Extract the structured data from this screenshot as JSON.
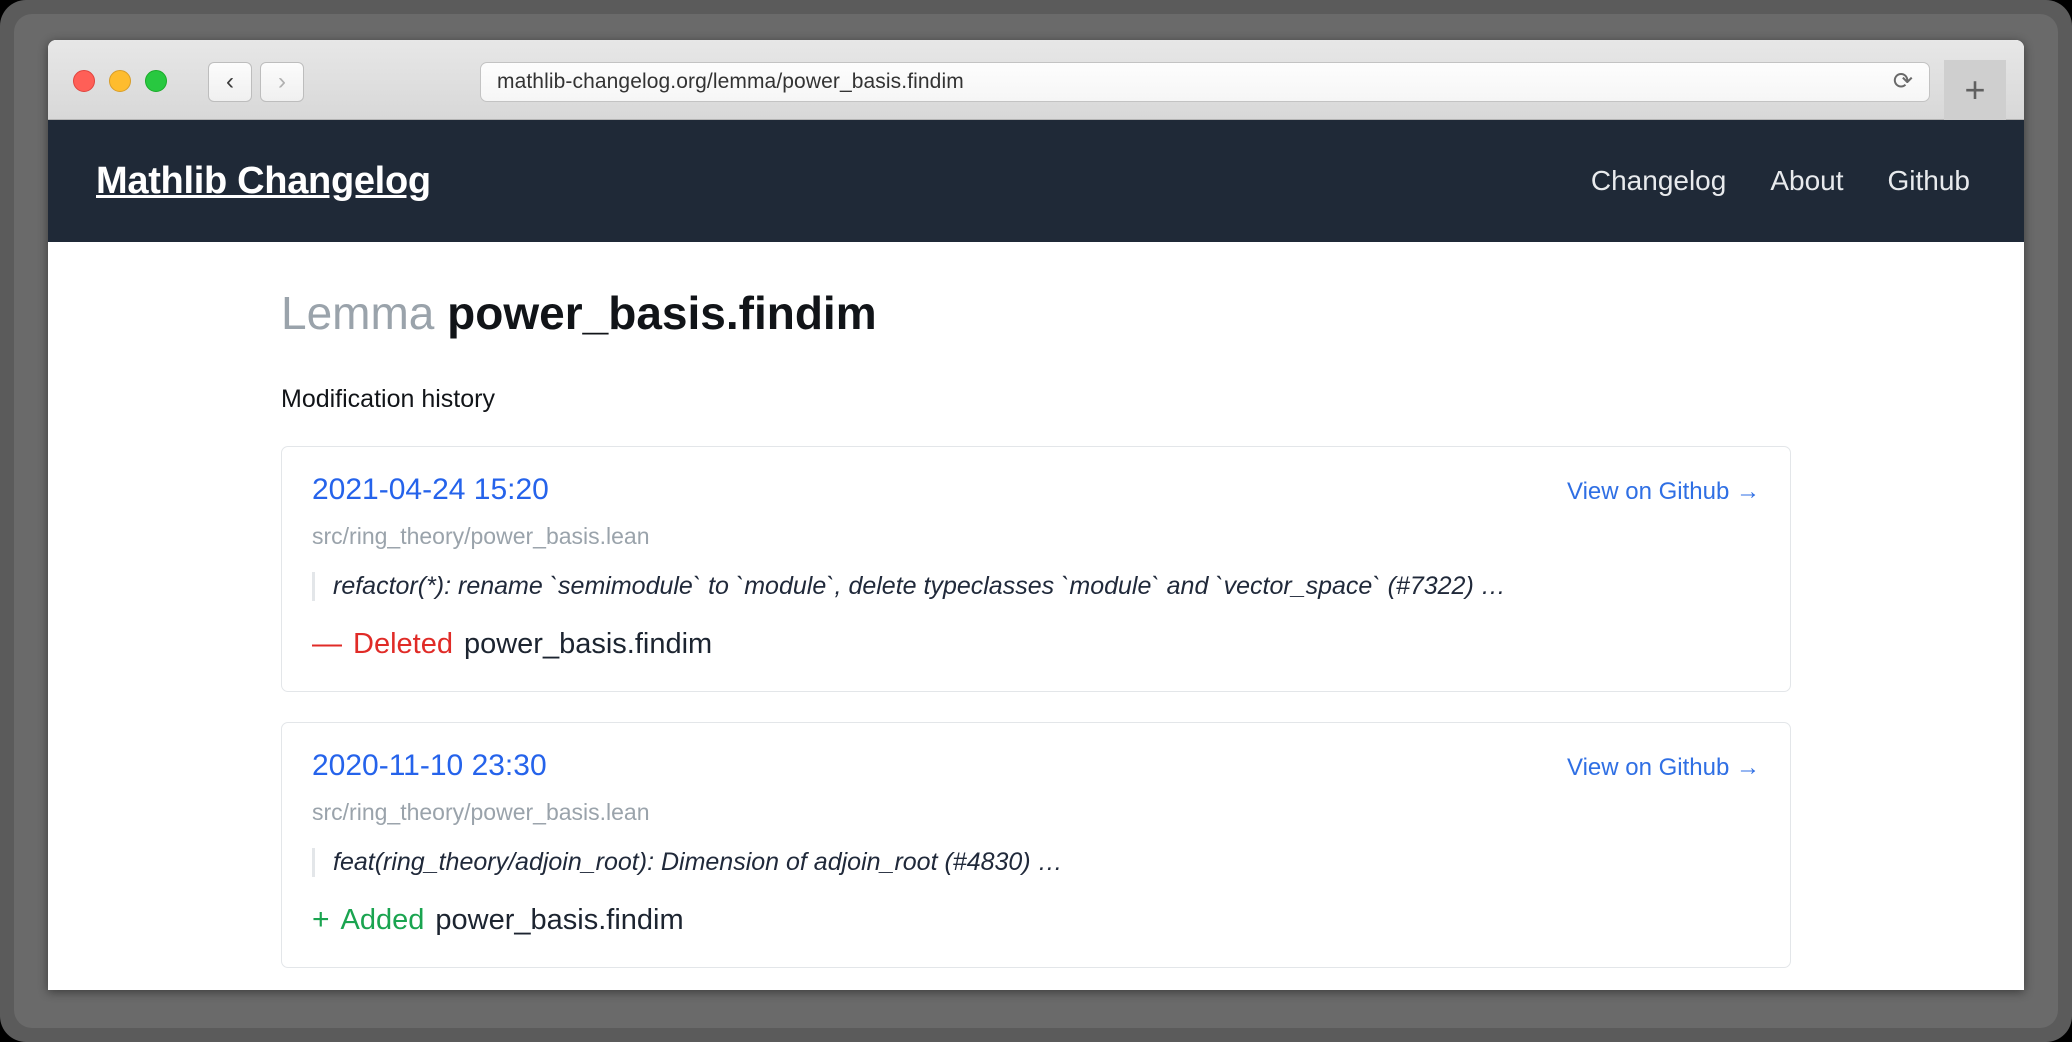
{
  "browser": {
    "url": "mathlib-changelog.org/lemma/power_basis.findim",
    "back_icon": "‹",
    "forward_icon": "›",
    "reload_icon": "⟳",
    "newtab_icon": "+"
  },
  "sitenav": {
    "brand": "Mathlib Changelog",
    "links": [
      {
        "label": "Changelog"
      },
      {
        "label": "About"
      },
      {
        "label": "Github"
      }
    ]
  },
  "page": {
    "title_kind": "Lemma",
    "title_name": "power_basis.findim",
    "subtitle": "Modification history"
  },
  "history": [
    {
      "date": "2021-04-24 15:20",
      "github_label": "View on Github →",
      "path": "src/ring_theory/power_basis.lean",
      "message": "refactor(*): rename `semimodule` to `module`, delete typeclasses `module` and `vector_space` (#7322) …",
      "change_sign": "—",
      "change_verb": "Deleted",
      "change_name": "power_basis.findim",
      "change_kind": "deleted"
    },
    {
      "date": "2020-11-10 23:30",
      "github_label": "View on Github →",
      "path": "src/ring_theory/power_basis.lean",
      "message": "feat(ring_theory/adjoin_root): Dimension of adjoin_root (#4830) …",
      "change_sign": "+",
      "change_verb": "Added",
      "change_name": "power_basis.findim",
      "change_kind": "added"
    }
  ],
  "colors": {
    "navbar_bg": "#1f2937",
    "link_blue": "#2563eb",
    "deleted_red": "#e02b27",
    "added_green": "#1aa450",
    "muted_gray": "#9aa3ab"
  }
}
